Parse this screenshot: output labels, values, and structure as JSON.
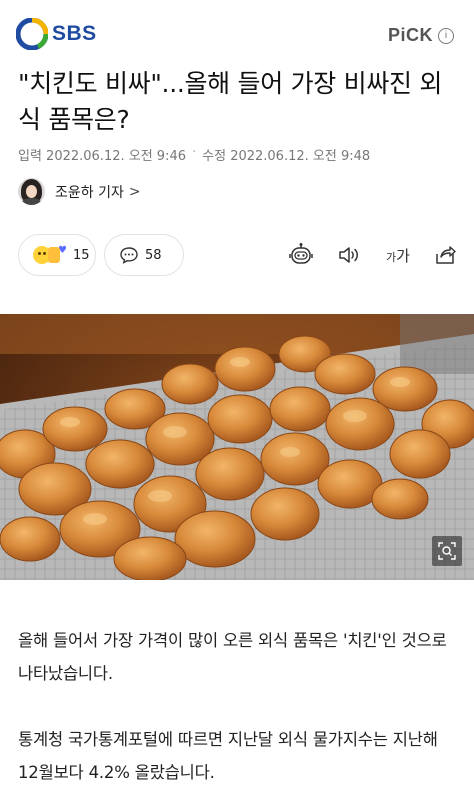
{
  "header": {
    "brand": "SBS",
    "pick_label": "PiCK",
    "pick_info": "i"
  },
  "article": {
    "headline": "\"치킨도 비싸\"...올해 들어 가장 비싸진 외식 품목은?",
    "published": "입력 2022.06.12. 오전 9:46",
    "modified": "수정 2022.06.12. 오전 9:48",
    "reporter": "조윤하 기자",
    "reporter_chevron": ">",
    "paragraphs": [
      "올해 들어서 가장 가격이 많이 오른 외식 품목은 '치킨'인 것으로 나타났습니다.",
      "통계청 국가통계포털에 따르면 지난달 외식 물가지수는 지난해 12월보다 4.2% 올랐습니다."
    ]
  },
  "actions": {
    "reaction_count": "15",
    "comment_count": "58",
    "font_label_small": "가",
    "font_label_large": "가"
  },
  "icons": {
    "logo": "sbs-logo-icon",
    "reaction": "reaction-emoji-icon",
    "comment": "comment-bubble-icon",
    "robot": "summary-robot-icon",
    "sound": "speaker-icon",
    "share": "share-icon",
    "zoom": "zoom-icon"
  },
  "colors": {
    "brand_blue": "#1f4ca0",
    "brand_yellow": "#f5b400",
    "brand_green": "#3aaa35"
  }
}
